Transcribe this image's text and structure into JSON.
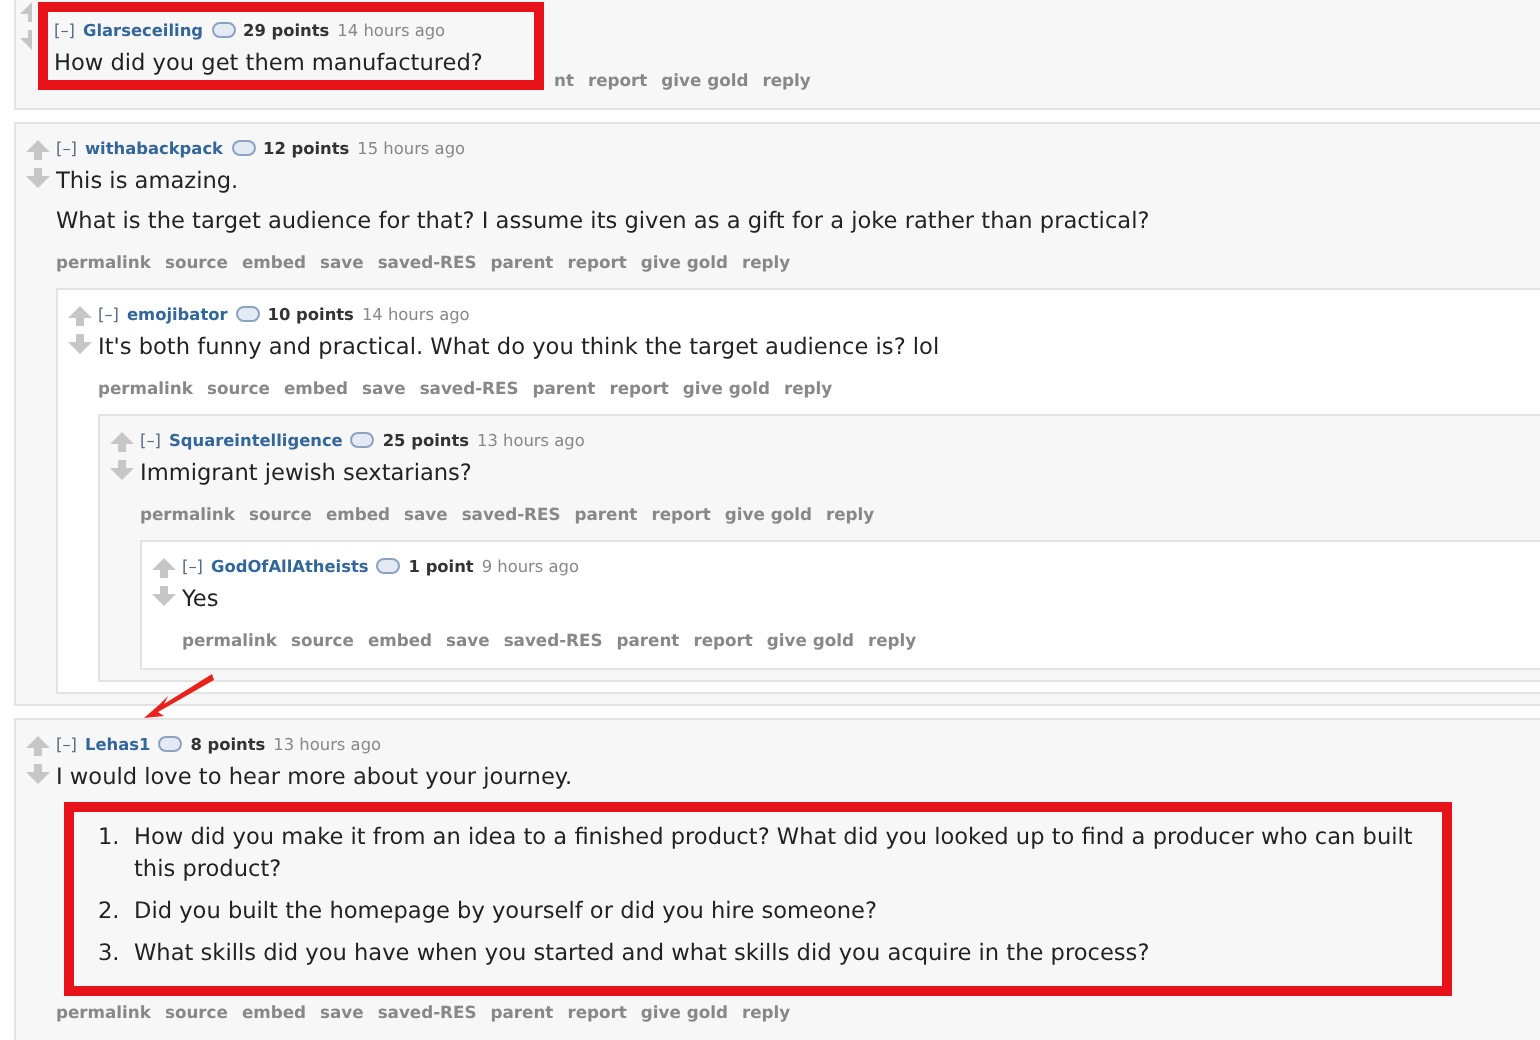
{
  "comments": [
    {
      "collapse": "[–]",
      "author": "Glarseceiling",
      "score": "29 points",
      "time": "14 hours ago",
      "highlighted": true,
      "body": [
        {
          "kind": "p",
          "text": "How did you get them manufactured?"
        }
      ],
      "actions": [
        "nt",
        "report",
        "give gold",
        "reply"
      ]
    },
    {
      "collapse": "[–]",
      "author": "withabackpack",
      "score": "12 points",
      "time": "15 hours ago",
      "body": [
        {
          "kind": "p",
          "text": "This is amazing."
        },
        {
          "kind": "p",
          "text": "What is the target audience for that? I assume its given as a gift for a joke rather than practical?"
        }
      ],
      "actions": [
        "permalink",
        "source",
        "embed",
        "save",
        "saved-RES",
        "parent",
        "report",
        "give gold",
        "reply"
      ],
      "children": [
        {
          "collapse": "[–]",
          "author": "emojibator",
          "score": "10 points",
          "time": "14 hours ago",
          "body": [
            {
              "kind": "p",
              "text": "It's both funny and practical. What do you think the target audience is? lol"
            }
          ],
          "actions": [
            "permalink",
            "source",
            "embed",
            "save",
            "saved-RES",
            "parent",
            "report",
            "give gold",
            "reply"
          ],
          "children": [
            {
              "collapse": "[–]",
              "author": "Squareintelligence",
              "score": "25 points",
              "time": "13 hours ago",
              "body": [
                {
                  "kind": "p",
                  "text": "Immigrant jewish sextarians?"
                }
              ],
              "actions": [
                "permalink",
                "source",
                "embed",
                "save",
                "saved-RES",
                "parent",
                "report",
                "give gold",
                "reply"
              ],
              "children": [
                {
                  "collapse": "[–]",
                  "author": "GodOfAllAtheists",
                  "score": "1 point",
                  "time": "9 hours ago",
                  "body": [
                    {
                      "kind": "p",
                      "text": "Yes"
                    }
                  ],
                  "actions": [
                    "permalink",
                    "source",
                    "embed",
                    "save",
                    "saved-RES",
                    "parent",
                    "report",
                    "give gold",
                    "reply"
                  ]
                }
              ]
            }
          ]
        }
      ]
    },
    {
      "collapse": "[–]",
      "author": "Lehas1",
      "score": "8 points",
      "time": "13 hours ago",
      "pointer": true,
      "body": [
        {
          "kind": "p",
          "text": "I would love to hear more about your journey."
        },
        {
          "kind": "ol",
          "highlighted": true,
          "items": [
            {
              "number": "1.",
              "text": "How did you make it from an idea to a finished product? What did you looked up to find a producer who can built this product?"
            },
            {
              "number": "2.",
              "text": "Did you built the homepage by yourself or did you hire someone?"
            },
            {
              "number": "3.",
              "text": "What skills did you have when you started and what skills did you acquire in the process?"
            }
          ]
        }
      ],
      "actions": [
        "permalink",
        "source",
        "embed",
        "save",
        "saved-RES",
        "parent",
        "report",
        "give gold",
        "reply"
      ]
    }
  ]
}
